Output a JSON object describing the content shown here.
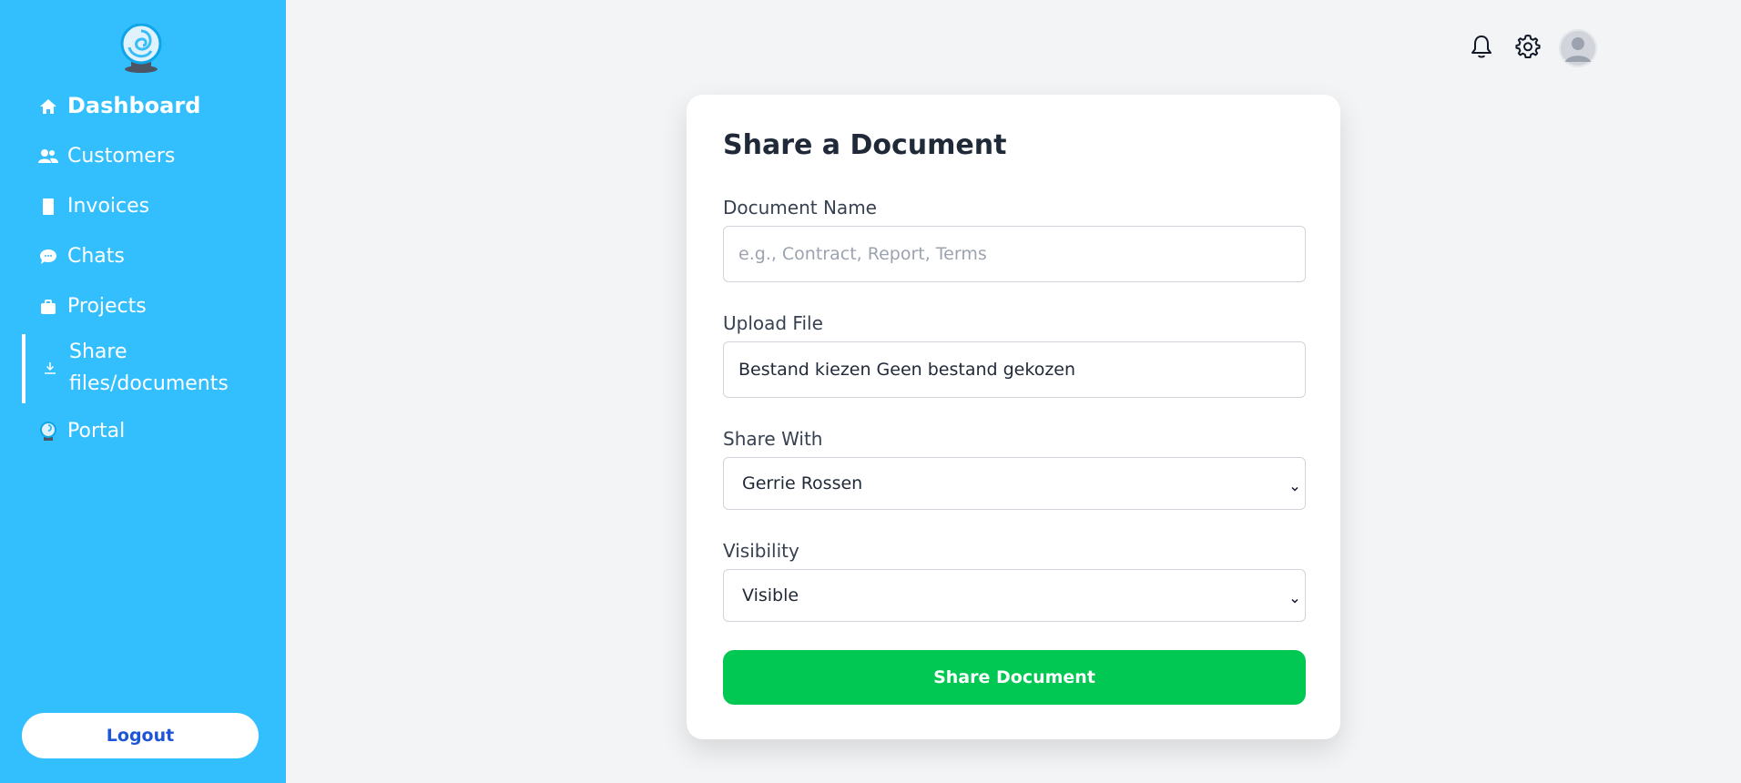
{
  "sidebar": {
    "logo": "portal-globe-logo",
    "items": [
      {
        "label": "Dashboard",
        "icon": "home-icon"
      },
      {
        "label": "Customers",
        "icon": "users-icon"
      },
      {
        "label": "Invoices",
        "icon": "document-icon"
      },
      {
        "label": "Chats",
        "icon": "chat-bubble-icon"
      },
      {
        "label": "Projects",
        "icon": "briefcase-icon"
      },
      {
        "label": "Share files/documents",
        "icon": "download-icon"
      },
      {
        "label": "Portal",
        "icon": "globe-icon"
      }
    ],
    "active_item": "Share files/documents",
    "logout_label": "Logout"
  },
  "topbar": {
    "icons": [
      "bell-icon",
      "gear-icon",
      "user-avatar"
    ]
  },
  "form": {
    "title": "Share a Document",
    "document_name": {
      "label": "Document Name",
      "placeholder": "e.g., Contract, Report, Terms",
      "value": ""
    },
    "upload_file": {
      "label": "Upload File",
      "button_text": "Bestand kiezen",
      "status_text": "Geen bestand gekozen"
    },
    "share_with": {
      "label": "Share With",
      "selected": "Gerrie Rossen"
    },
    "visibility": {
      "label": "Visibility",
      "selected": "Visible"
    },
    "submit_label": "Share Document"
  },
  "colors": {
    "sidebar_bg": "#33bffd",
    "page_bg": "#f3f4f6",
    "submit_bg": "#00c853",
    "logout_text": "#1e55d6"
  }
}
